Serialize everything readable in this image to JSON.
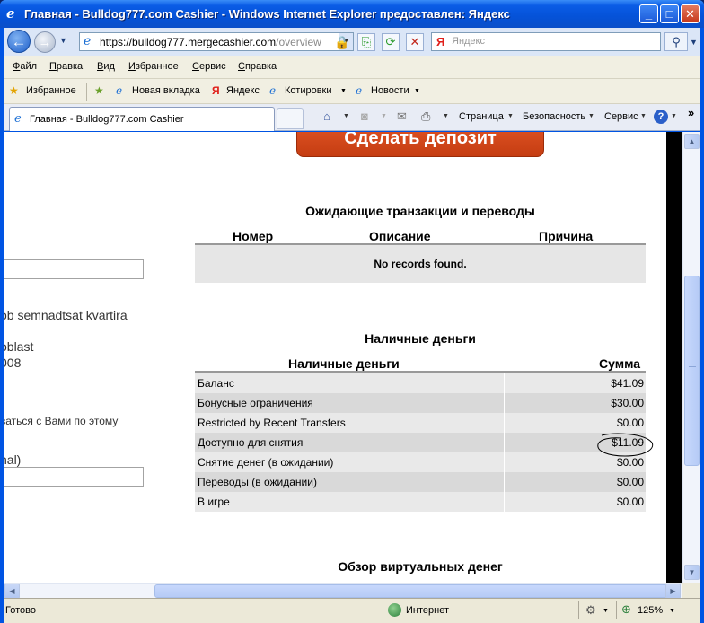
{
  "window": {
    "title": "Главная - Bulldog777.com Cashier - Windows Internet Explorer предоставлен: Яндекс"
  },
  "nav": {
    "url_prefix": "https://bulldog777.",
    "url_domain": "mergecashier.com",
    "url_path": "/overview",
    "search_placeholder": "Яндекс"
  },
  "menu": [
    "Файл",
    "Правка",
    "Вид",
    "Избранное",
    "Сервис",
    "Справка"
  ],
  "favorites": {
    "label": "Избранное",
    "items": [
      "Новая вкладка",
      "Яндекс",
      "Котировки",
      "Новости"
    ]
  },
  "tab": {
    "label": "Главная - Bulldog777.com Cashier"
  },
  "commands": [
    "Страница",
    "Безопасность",
    "Сервис"
  ],
  "page": {
    "deposit_button": "Сделать депозит",
    "left_fragments": {
      "address1": "ob semnadtsat kvartira",
      "address2": "oblast",
      "address3": "008",
      "contact": "ваться с Вами по этому",
      "optional": "nal)"
    },
    "pending": {
      "title": "Ожидающие транзакции и переводы",
      "columns": [
        "Номер",
        "Описание",
        "Причина"
      ],
      "empty": "No records found."
    },
    "cash": {
      "title": "Наличные деньги",
      "columns": [
        "Наличные деньги",
        "Сумма"
      ],
      "rows": [
        {
          "label": "Баланс",
          "value": "$41.09"
        },
        {
          "label": "Бонусные ограничения",
          "value": "$30.00"
        },
        {
          "label": "Restricted by Recent Transfers",
          "value": "$0.00"
        },
        {
          "label": "Доступно для снятия",
          "value": "$11.09"
        },
        {
          "label": "Снятие денег (в ожидании)",
          "value": "$0.00"
        },
        {
          "label": "Переводы (в ожидании)",
          "value": "$0.00"
        },
        {
          "label": "В игре",
          "value": "$0.00"
        }
      ]
    },
    "virtual_title": "Обзор виртуальных денег"
  },
  "status": {
    "text": "Готово",
    "zone": "Интернет",
    "zoom": "125%"
  }
}
